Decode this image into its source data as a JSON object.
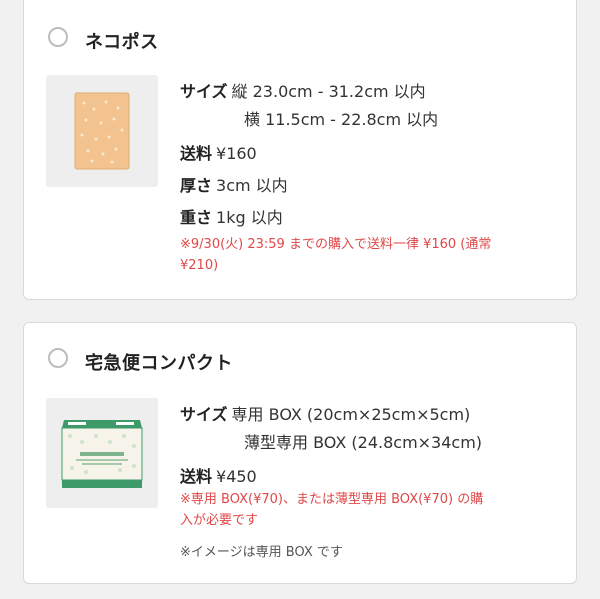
{
  "options": [
    {
      "title": "ネコポス",
      "image_icon": "nekopos-envelope-image",
      "size_label": "サイズ",
      "size_line1": "縦 23.0cm - 31.2cm 以内",
      "size_line2": "横 11.5cm - 22.8cm 以内",
      "fee_label": "送料",
      "fee_value": "¥160",
      "thickness_label": "厚さ",
      "thickness_value": "3cm 以内",
      "weight_label": "重さ",
      "weight_value": "1kg 以内",
      "note_line1": "※9/30(火) 23:59 までの購入で送料一律 ¥160 (通常",
      "note_line2": "¥210)"
    },
    {
      "title": "宅急便コンパクト",
      "image_icon": "compact-box-image",
      "size_label": "サイズ",
      "size_line1": "専用 BOX (20cm×25cm×5cm)",
      "size_line2": "薄型専用 BOX (24.8cm×34cm)",
      "fee_label": "送料",
      "fee_value": "¥450",
      "note_line1": "※専用 BOX(¥70)、または薄型専用 BOX(¥70) の購",
      "note_line2": "入が必要です",
      "image_note": "※イメージは専用 BOX です"
    }
  ],
  "colors": {
    "note_red": "#e04848",
    "box_green": "#3f9a6a",
    "envelope_tan": "#f2c38f"
  }
}
